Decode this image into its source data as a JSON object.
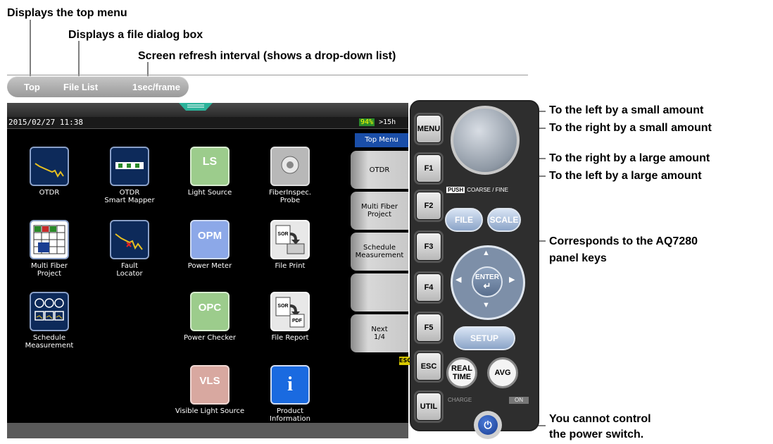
{
  "annotations": {
    "top_menu": "Displays the top menu",
    "file_dialog": "Displays a file dialog box",
    "refresh": "Screen refresh interval (shows a drop-down list)",
    "left_small": "To the left by a small amount",
    "right_small": "To the right by a small amount",
    "right_large": "To the right by a large amount",
    "left_large": "To the left by a large amount",
    "panel_keys_1": "Corresponds to the AQ7280",
    "panel_keys_2": "panel keys",
    "power_1": "You cannot control",
    "power_2": "the power switch."
  },
  "toolbar": {
    "top": "Top",
    "file_list": "File List",
    "refresh": "1sec/frame"
  },
  "status": {
    "datetime": "2015/02/27 11:38",
    "battery_pct": "94%",
    "battery_time": ">15h"
  },
  "apps": [
    {
      "label": "OTDR"
    },
    {
      "label": "OTDR\nSmart Mapper"
    },
    {
      "label": "Light Source",
      "icon_text": "LS"
    },
    {
      "label": "FiberInspec.\nProbe"
    },
    {
      "label": "Multi Fiber\nProject"
    },
    {
      "label": "Fault\nLocator"
    },
    {
      "label": "Power Meter",
      "icon_text": "OPM"
    },
    {
      "label": "File Print",
      "icon_text": "SOR"
    },
    {
      "label": "Schedule\nMeasurement"
    },
    {
      "label": "Power Checker",
      "icon_text": "OPC"
    },
    {
      "label": "File Report",
      "icon_text": "SOR",
      "icon_text2": "PDF"
    },
    {
      "label": "Visible Light Source",
      "icon_text": "VLS"
    },
    {
      "label": "Product\nInformation",
      "icon_text": "i"
    }
  ],
  "side_menu": {
    "header": "Top Menu",
    "items": [
      "OTDR",
      "Multi Fiber\nProject",
      "Schedule\nMeasurement",
      "",
      "Next\n1/4"
    ],
    "esc": "ESC"
  },
  "panel": {
    "menu": "MENU",
    "f1": "F1",
    "f2": "F2",
    "f3": "F3",
    "f4": "F4",
    "f5": "F5",
    "esc": "ESC",
    "util": "UTIL",
    "push": "PUSH",
    "coarse_fine": "COARSE / FINE",
    "file": "FILE",
    "scale": "SCALE",
    "enter": "ENTER",
    "setup": "SETUP",
    "realtime": "REAL\nTIME",
    "avg": "AVG",
    "charge": "CHARGE",
    "on": "ON"
  },
  "colors": {
    "menu_header": "#1a4ea8",
    "accent_blue": "#1a3e92"
  }
}
